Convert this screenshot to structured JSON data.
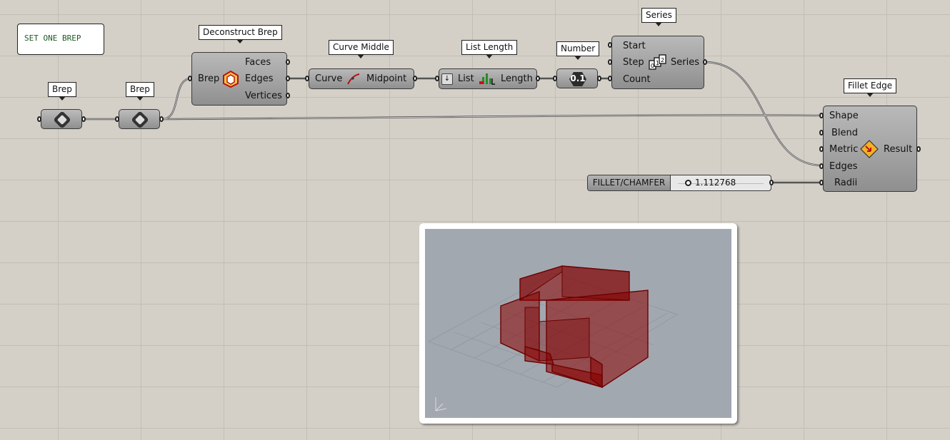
{
  "canvas": {
    "note": "SET ONE BREP"
  },
  "components": {
    "brep1": {
      "tag": "Brep"
    },
    "brep2": {
      "tag": "Brep"
    },
    "deconstruct": {
      "tag": "Deconstruct Brep",
      "inputs": [
        "Brep"
      ],
      "outputs": [
        "Faces",
        "Edges",
        "Vertices"
      ]
    },
    "curve_middle": {
      "tag": "Curve Middle",
      "input": "Curve",
      "output": "Midpoint"
    },
    "list_length": {
      "tag": "List Length",
      "input": "List",
      "output": "Length"
    },
    "number": {
      "tag": "Number",
      "icon_text": "0.1"
    },
    "series": {
      "tag": "Series",
      "inputs": [
        "Start",
        "Step",
        "Count"
      ],
      "output": "Series"
    },
    "fillet_edge": {
      "tag": "Fillet Edge",
      "inputs": [
        "Shape",
        "Blend",
        "Metric",
        "Edges",
        "Radii"
      ],
      "output": "Result"
    },
    "slider": {
      "label": "FILLET/CHAMFER",
      "value": "1.112768"
    }
  },
  "icons": {
    "brep_param": "brep-hex-icon",
    "deconstruct": "deconstruct-brep-icon",
    "curve_middle": "curve-middle-icon",
    "list_length": "list-length-icon",
    "series": "series-icon",
    "fillet": "fillet-edge-icon",
    "axes": "axes-icon"
  },
  "colors": {
    "canvas": "#d4d0c8",
    "grid": "#c2beb6",
    "component": "#a5a5a5",
    "wire": "#555555",
    "viewport": "#a2a8b0",
    "geometry": "#8b0000"
  }
}
